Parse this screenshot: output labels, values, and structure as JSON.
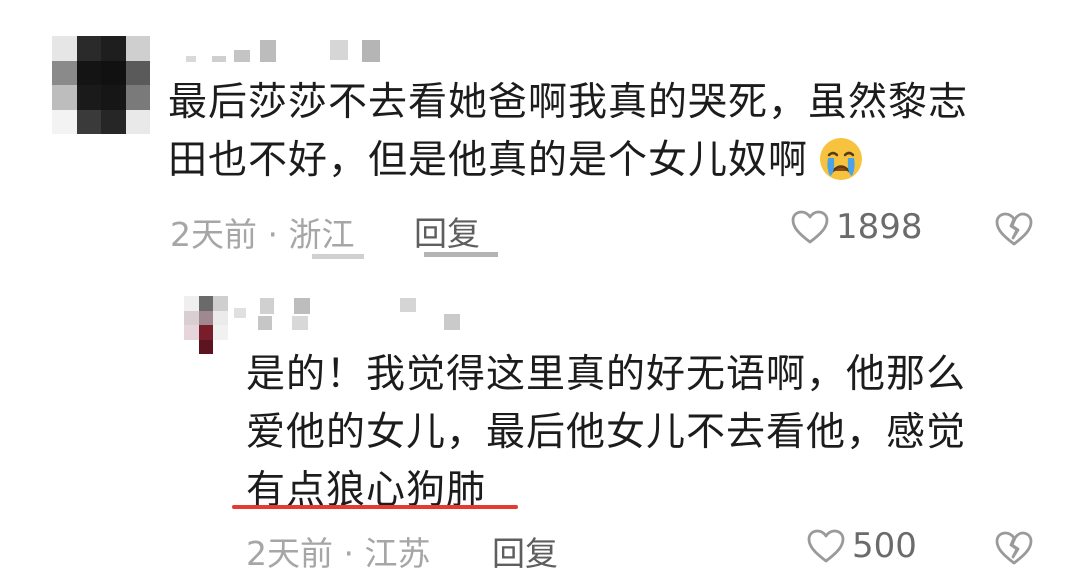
{
  "colors": {
    "meta_gray": "#a6a6a6",
    "reply_gray": "#5e5e5e",
    "text": "#1c1c1c",
    "underline_red": "#e43a2f",
    "emoji_yellow": "#f7c23d",
    "emoji_tear": "#4aa3e8"
  },
  "comments": [
    {
      "text_lines": [
        "最后莎莎不去看她爸啊我真的哭死，虽然黎志",
        "田也不好，但是他真的是个女儿奴啊"
      ],
      "emoji": "crying-face-icon",
      "time": "2天前",
      "location": "浙江",
      "reply_label": "回复",
      "likes": "1898"
    },
    {
      "text_lines": [
        "是的！我觉得这里真的好无语啊，他那么",
        "爱他的女儿，最后他女儿不去看他，感觉",
        "有点狼心狗肺"
      ],
      "time": "2天前",
      "location": "江苏",
      "reply_label": "回复",
      "likes": "500"
    }
  ],
  "separator": "·"
}
